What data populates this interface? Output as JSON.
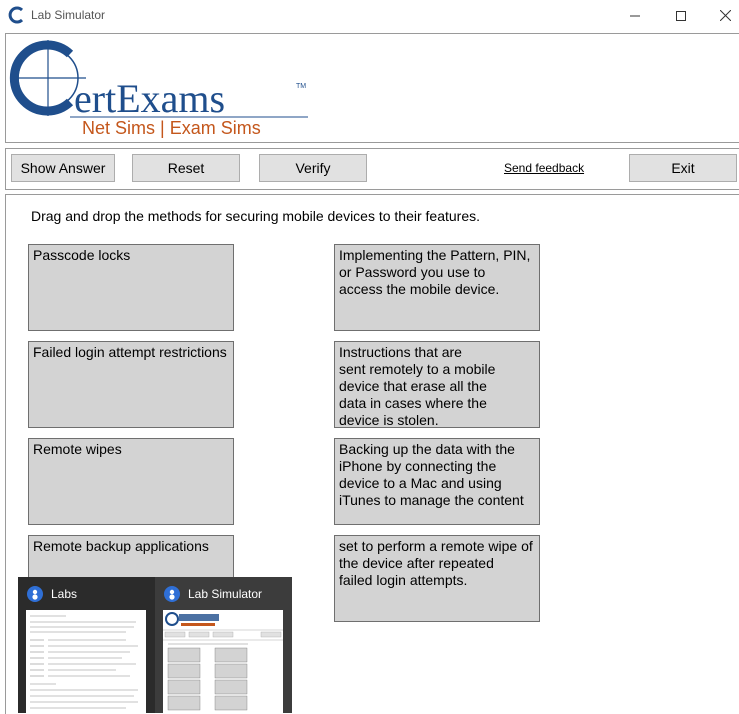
{
  "window": {
    "title": "Lab Simulator"
  },
  "logo": {
    "wordmark": "ertExams",
    "tagline": "Net Sims | Exam Sims",
    "tm": "TM"
  },
  "toolbar": {
    "show_answer": "Show Answer",
    "reset": "Reset",
    "verify": "Verify",
    "send_feedback": "Send feedback",
    "exit": "Exit"
  },
  "main": {
    "instruction": "Drag and drop the methods for securing mobile devices to their features.",
    "methods": [
      "Passcode locks",
      "Failed login attempt restrictions",
      "Remote wipes",
      "Remote backup applications"
    ],
    "features": [
      "Implementing the Pattern, PIN,\nor Password  you use to\naccess the mobile device.",
      "Instructions that are\nsent remotely to a mobile\ndevice that erase all the\ndata in cases where the\ndevice is stolen.",
      "Backing up the data with the\niPhone by connecting the\ndevice to a Mac and using\niTunes to manage the content",
      "set to perform a remote wipe of\nthe device after repeated\nfailed login attempts."
    ]
  },
  "taskbar": {
    "items": [
      {
        "label": "Labs"
      },
      {
        "label": "Lab Simulator"
      }
    ]
  },
  "colors": {
    "logo_blue": "#1f4e8c",
    "logo_orange": "#c4571c",
    "box_fill": "#d3d3d3",
    "taskbar_bg": "#2b2b2b"
  }
}
